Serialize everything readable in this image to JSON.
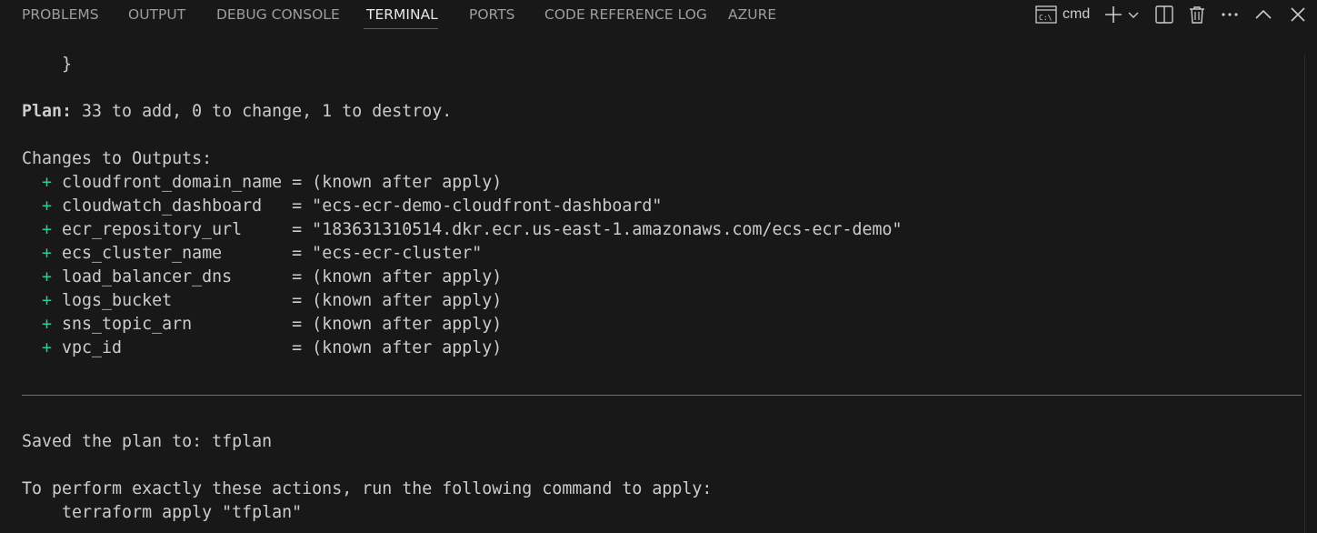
{
  "panel": {
    "tabs": [
      {
        "label": "PROBLEMS",
        "active": false
      },
      {
        "label": "OUTPUT",
        "active": false
      },
      {
        "label": "DEBUG CONSOLE",
        "active": false
      },
      {
        "label": "TERMINAL",
        "active": true
      },
      {
        "label": "PORTS",
        "active": false
      },
      {
        "label": "CODE REFERENCE LOG",
        "active": false
      },
      {
        "label": "AZURE",
        "active": false
      }
    ],
    "accent_color": "#0078d4",
    "toolbar": {
      "terminal_icon": "cmd-terminal-icon",
      "terminal_name": "cmd",
      "new_terminal_icon": "plus-icon",
      "dropdown_icon": "chevron-down-icon",
      "split_icon": "split-editor-icon",
      "kill_icon": "trash-icon",
      "more_icon": "ellipsis-icon",
      "maximize_icon": "chevron-up-icon",
      "close_icon": "close-icon"
    }
  },
  "terminal": {
    "closing_brace": "    }",
    "plan_label": "Plan:",
    "plan_text": " 33 to add, 0 to change, 1 to destroy.",
    "outputs_header": "Changes to Outputs:",
    "plus_color": "#23d18b",
    "outputs": [
      {
        "prefix": "  + ",
        "text": "cloudfront_domain_name = (known after apply)"
      },
      {
        "prefix": "  + ",
        "text": "cloudwatch_dashboard   = \"ecs-ecr-demo-cloudfront-dashboard\""
      },
      {
        "prefix": "  + ",
        "text": "ecr_repository_url     = \"183631310514.dkr.ecr.us-east-1.amazonaws.com/ecs-ecr-demo\""
      },
      {
        "prefix": "  + ",
        "text": "ecs_cluster_name       = \"ecs-ecr-cluster\""
      },
      {
        "prefix": "  + ",
        "text": "load_balancer_dns      = (known after apply)"
      },
      {
        "prefix": "  + ",
        "text": "logs_bucket            = (known after apply)"
      },
      {
        "prefix": "  + ",
        "text": "sns_topic_arn          = (known after apply)"
      },
      {
        "prefix": "  + ",
        "text": "vpc_id                 = (known after apply)"
      }
    ],
    "saved_plan": "Saved the plan to: tfplan",
    "perform_text": "To perform exactly these actions, run the following command to apply:",
    "apply_command": "    terraform apply \"tfplan\""
  }
}
